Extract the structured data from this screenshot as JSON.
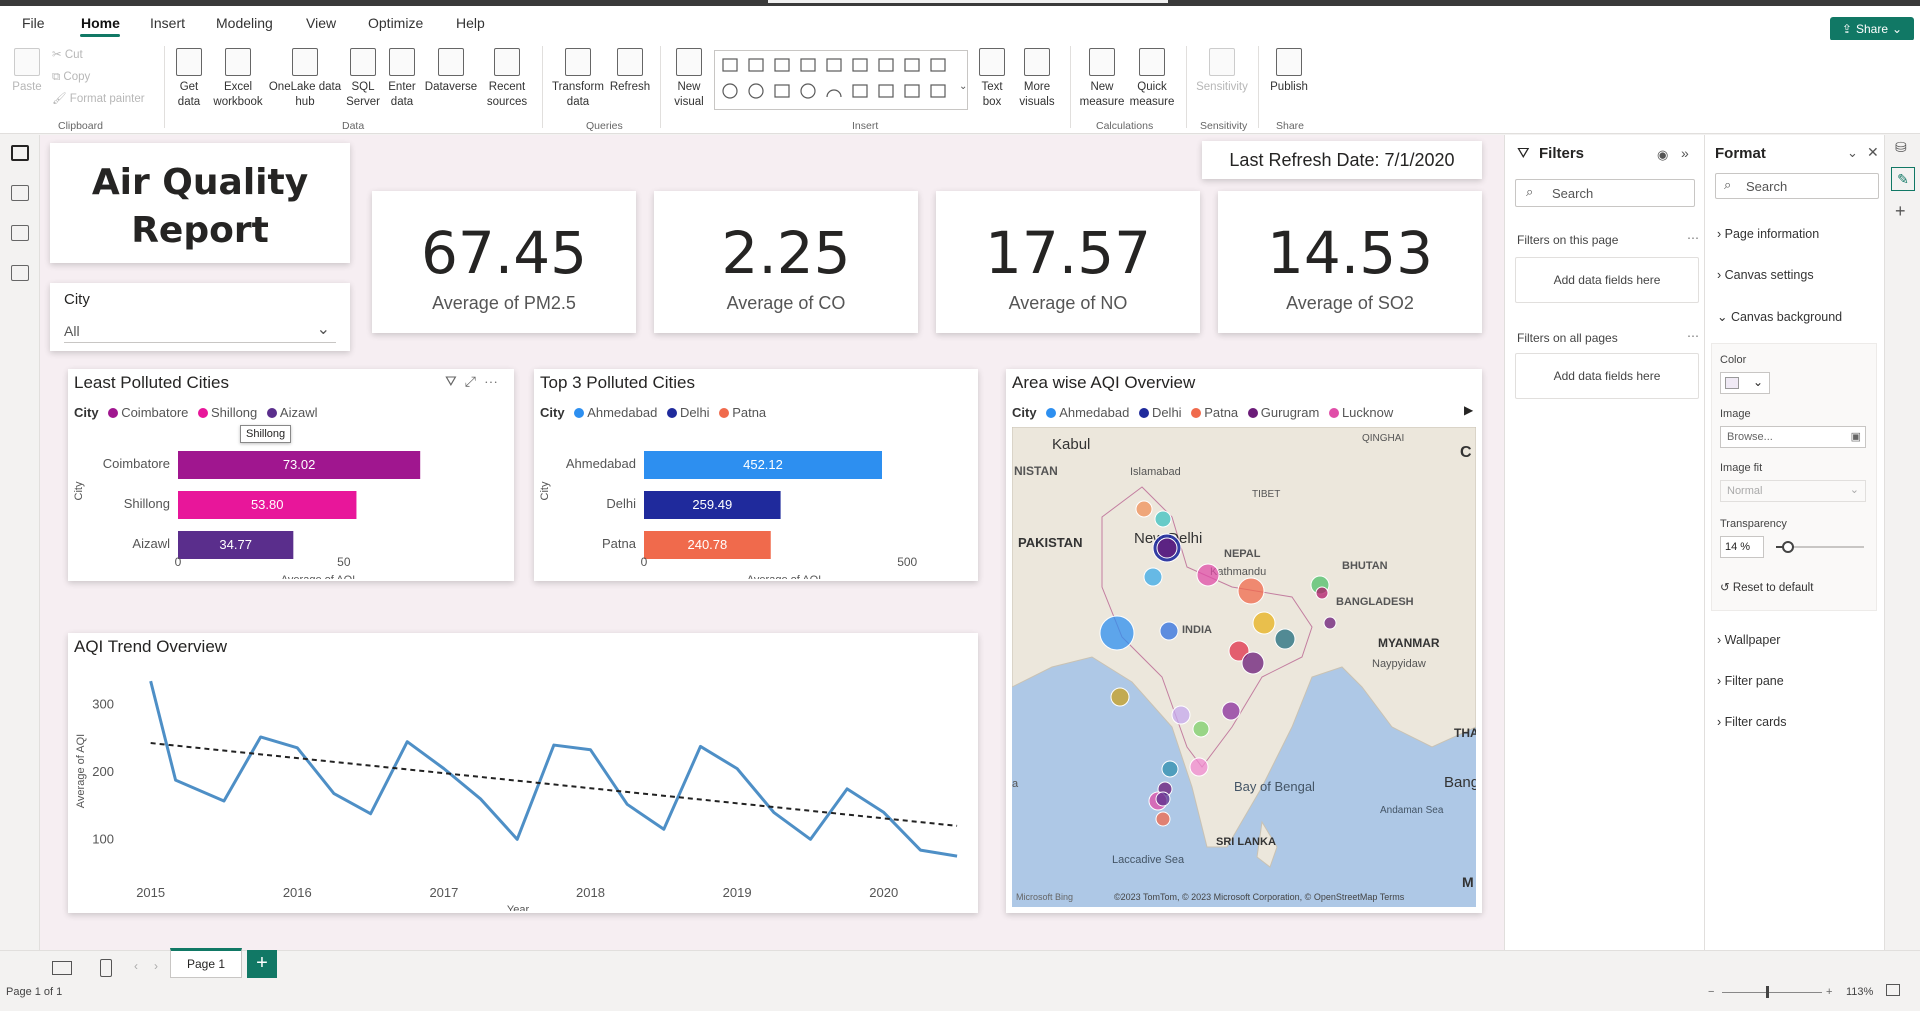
{
  "menu": {
    "items": [
      "File",
      "Home",
      "Insert",
      "Modeling",
      "View",
      "Optimize",
      "Help"
    ],
    "active": "Home",
    "share_label": "Share"
  },
  "ribbon": {
    "clipboard": {
      "paste": "Paste",
      "cut": "Cut",
      "copy": "Copy",
      "format_painter": "Format painter",
      "group": "Clipboard"
    },
    "data": {
      "get_data": "Get data",
      "excel": "Excel workbook",
      "onelake": "OneLake data hub",
      "sql": "SQL Server",
      "enter": "Enter data",
      "dataverse": "Dataverse",
      "recent": "Recent sources",
      "group": "Data"
    },
    "queries": {
      "transform": "Transform data",
      "refresh": "Refresh",
      "group": "Queries"
    },
    "insert": {
      "new_visual": "New visual",
      "text_box": "Text box",
      "more_visuals": "More visuals",
      "group": "Insert"
    },
    "calculations": {
      "new_measure": "New measure",
      "quick_measure": "Quick measure",
      "group": "Calculations"
    },
    "sensitivity": {
      "label": "Sensitivity",
      "group": "Sensitivity"
    },
    "share": {
      "publish": "Publish",
      "group": "Share"
    }
  },
  "report": {
    "title": "Air Quality Report",
    "refresh": "Last Refresh Date: 7/1/2020",
    "slicer": {
      "label": "City",
      "value": "All"
    },
    "kpis": [
      {
        "value": "67.45",
        "label": "Average of PM2.5"
      },
      {
        "value": "2.25",
        "label": "Average of CO"
      },
      {
        "value": "17.57",
        "label": "Average of NO"
      },
      {
        "value": "14.53",
        "label": "Average of SO2"
      }
    ],
    "least": {
      "title": "Least Polluted Cities",
      "legend_title": "City",
      "tooltip": "Shillong",
      "categories": [
        "Coimbatore",
        "Shillong",
        "Aizawl"
      ],
      "values": [
        73.02,
        53.8,
        34.77
      ],
      "labels": [
        "73.02",
        "53.80",
        "34.77"
      ],
      "colors": [
        "#a0168f",
        "#e8169a",
        "#5a2e8c"
      ],
      "ticks": [
        "0",
        "50"
      ],
      "xlabel": "Average of AQI",
      "ylabel": "City"
    },
    "top3": {
      "title": "Top 3 Polluted Cities",
      "legend_title": "City",
      "categories": [
        "Ahmedabad",
        "Delhi",
        "Patna"
      ],
      "values": [
        452.12,
        259.49,
        240.78
      ],
      "labels": [
        "452.12",
        "259.49",
        "240.78"
      ],
      "colors": [
        "#2d8ff0",
        "#1f2a9c",
        "#f06a4c"
      ],
      "ticks": [
        "0",
        "500"
      ],
      "xlabel": "Average of AQI",
      "ylabel": "City"
    },
    "map": {
      "title": "Area wise AQI Overview",
      "legend_title": "City",
      "legend": [
        {
          "name": "Ahmedabad",
          "color": "#2d8ff0"
        },
        {
          "name": "Delhi",
          "color": "#1f2a9c"
        },
        {
          "name": "Patna",
          "color": "#f06a4c"
        },
        {
          "name": "Gurugram",
          "color": "#6b1b78"
        },
        {
          "name": "Lucknow",
          "color": "#e04ea8"
        }
      ],
      "labels": [
        "Kabul",
        "NISTAN",
        "Islamabad",
        "PAKISTAN",
        "New Delhi",
        "NEPAL",
        "Kathmandu",
        "BHUTAN",
        "BANGLADESH",
        "INDIA",
        "MYANMAR",
        "Naypyidaw",
        "QINGHAI",
        "TIBET",
        "Bay of Bengal",
        "Andaman Sea",
        "SRI LANKA",
        "Laccadive Sea",
        "THA",
        "Bang",
        "C",
        "M",
        "a"
      ],
      "attribution": "©2023 TomTom, © 2023 Microsoft Corporation, © OpenStreetMap  Terms",
      "bing": "Microsoft Bing"
    },
    "trend": {
      "title": "AQI Trend Overview",
      "ylabel": "Average of AQI",
      "xlabel": "Year"
    }
  },
  "chart_data": {
    "type": "line",
    "title": "AQI Trend Overview",
    "xlabel": "Year",
    "ylabel": "Average of AQI",
    "x": [
      2015.0,
      2015.17,
      2015.5,
      2015.75,
      2016.0,
      2016.25,
      2016.5,
      2016.75,
      2017.0,
      2017.25,
      2017.5,
      2017.75,
      2018.0,
      2018.25,
      2018.5,
      2018.75,
      2019.0,
      2019.25,
      2019.5,
      2019.75,
      2020.0,
      2020.25,
      2020.5
    ],
    "y": [
      335,
      188,
      157,
      252,
      236,
      168,
      138,
      245,
      205,
      160,
      100,
      240,
      233,
      152,
      115,
      238,
      205,
      140,
      100,
      175,
      140,
      84,
      75
    ],
    "trendline": {
      "start": [
        2015.0,
        243
      ],
      "end": [
        2020.5,
        120
      ]
    },
    "xticks": [
      "2015",
      "2016",
      "2017",
      "2018",
      "2019",
      "2020"
    ],
    "yticks": [
      "100",
      "200",
      "300"
    ],
    "ylim": [
      50,
      350
    ],
    "xlim": [
      2014.9,
      2020.52
    ],
    "color": "#4e8fc6"
  },
  "filters": {
    "title": "Filters",
    "search": "Search",
    "on_page": "Filters on this page",
    "on_all": "Filters on all pages",
    "add": "Add data fields here"
  },
  "format": {
    "title": "Format",
    "search": "Search",
    "sections": [
      "Page information",
      "Canvas settings",
      "Canvas background",
      "Wallpaper",
      "Filter pane",
      "Filter cards"
    ],
    "color_label": "Color",
    "image_label": "Image",
    "browse": "Browse...",
    "image_fit_label": "Image fit",
    "image_fit": "Normal",
    "transparency_label": "Transparency",
    "transparency": "14 %",
    "transparency_value": 14,
    "reset": "Reset to default"
  },
  "bottom": {
    "page_tab": "Page 1",
    "status": "Page 1 of 1",
    "zoom": "113%"
  }
}
